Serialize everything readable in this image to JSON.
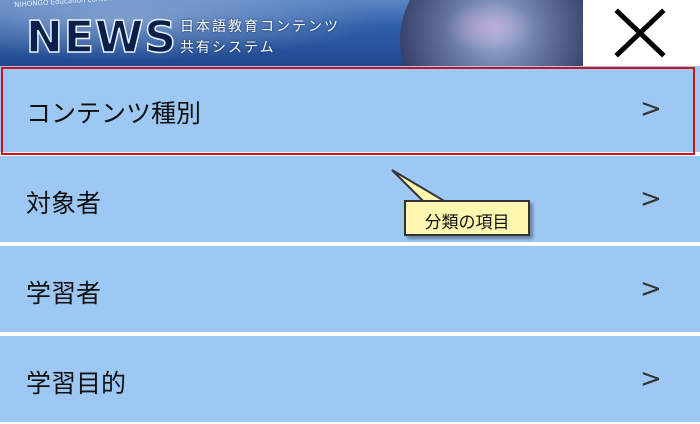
{
  "header": {
    "tagline": "NIHONGO Education contents Web sharing System",
    "logo": "NEWS",
    "subtitle_line1": "日本語教育コンテンツ",
    "subtitle_line2": "共有システム",
    "close_icon": "close-icon"
  },
  "menu": {
    "items": [
      {
        "label": "コンテンツ種別",
        "chevron": ">"
      },
      {
        "label": "対象者",
        "chevron": ">"
      },
      {
        "label": "学習者",
        "chevron": ">"
      },
      {
        "label": "学習目的",
        "chevron": ">"
      }
    ]
  },
  "annotation": {
    "callout_text": "分類の項目",
    "highlight_color": "#d0121b",
    "callout_color": "#fff7b0"
  },
  "colors": {
    "menu_bg": "#9ec8f4",
    "banner_bg": "#2f5fa8"
  }
}
